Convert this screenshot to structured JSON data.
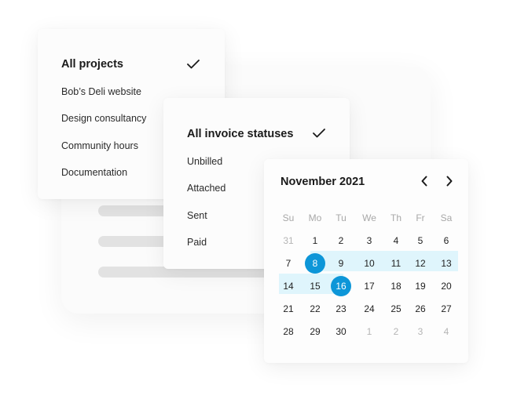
{
  "projects_menu": {
    "items": [
      {
        "label": "All projects",
        "selected": true
      },
      {
        "label": "Bob’s Deli website",
        "selected": false
      },
      {
        "label": "Design consultancy",
        "selected": false
      },
      {
        "label": "Community hours",
        "selected": false
      },
      {
        "label": "Documentation",
        "selected": false
      }
    ],
    "check_icon": "check-icon"
  },
  "invoice_menu": {
    "items": [
      {
        "label": "All invoice statuses",
        "selected": true
      },
      {
        "label": "Unbilled",
        "selected": false
      },
      {
        "label": "Attached",
        "selected": false
      },
      {
        "label": "Sent",
        "selected": false
      },
      {
        "label": "Paid",
        "selected": false
      }
    ],
    "check_icon": "check-icon"
  },
  "calendar": {
    "title": "November 2021",
    "prev_icon": "chevron-left-icon",
    "next_icon": "chevron-right-icon",
    "weekdays": [
      "Su",
      "Mo",
      "Tu",
      "We",
      "Th",
      "Fr",
      "Sa"
    ],
    "weeks": [
      [
        {
          "d": "31",
          "m": true
        },
        {
          "d": "1"
        },
        {
          "d": "2"
        },
        {
          "d": "3"
        },
        {
          "d": "4"
        },
        {
          "d": "5"
        },
        {
          "d": "6"
        }
      ],
      [
        {
          "d": "7"
        },
        {
          "d": "8",
          "sel": true
        },
        {
          "d": "9"
        },
        {
          "d": "10"
        },
        {
          "d": "11"
        },
        {
          "d": "12"
        },
        {
          "d": "13"
        }
      ],
      [
        {
          "d": "14"
        },
        {
          "d": "15"
        },
        {
          "d": "16",
          "sel": true
        },
        {
          "d": "17"
        },
        {
          "d": "18"
        },
        {
          "d": "19"
        },
        {
          "d": "20"
        }
      ],
      [
        {
          "d": "21"
        },
        {
          "d": "22"
        },
        {
          "d": "23"
        },
        {
          "d": "24"
        },
        {
          "d": "25"
        },
        {
          "d": "26"
        },
        {
          "d": "27"
        }
      ],
      [
        {
          "d": "28"
        },
        {
          "d": "29"
        },
        {
          "d": "30"
        },
        {
          "d": "1",
          "m": true
        },
        {
          "d": "2",
          "m": true
        },
        {
          "d": "3",
          "m": true
        },
        {
          "d": "4",
          "m": true
        }
      ]
    ],
    "range_start": "8",
    "range_end": "16",
    "accent_color": "#0d96d8",
    "range_color": "#dff5fc"
  }
}
